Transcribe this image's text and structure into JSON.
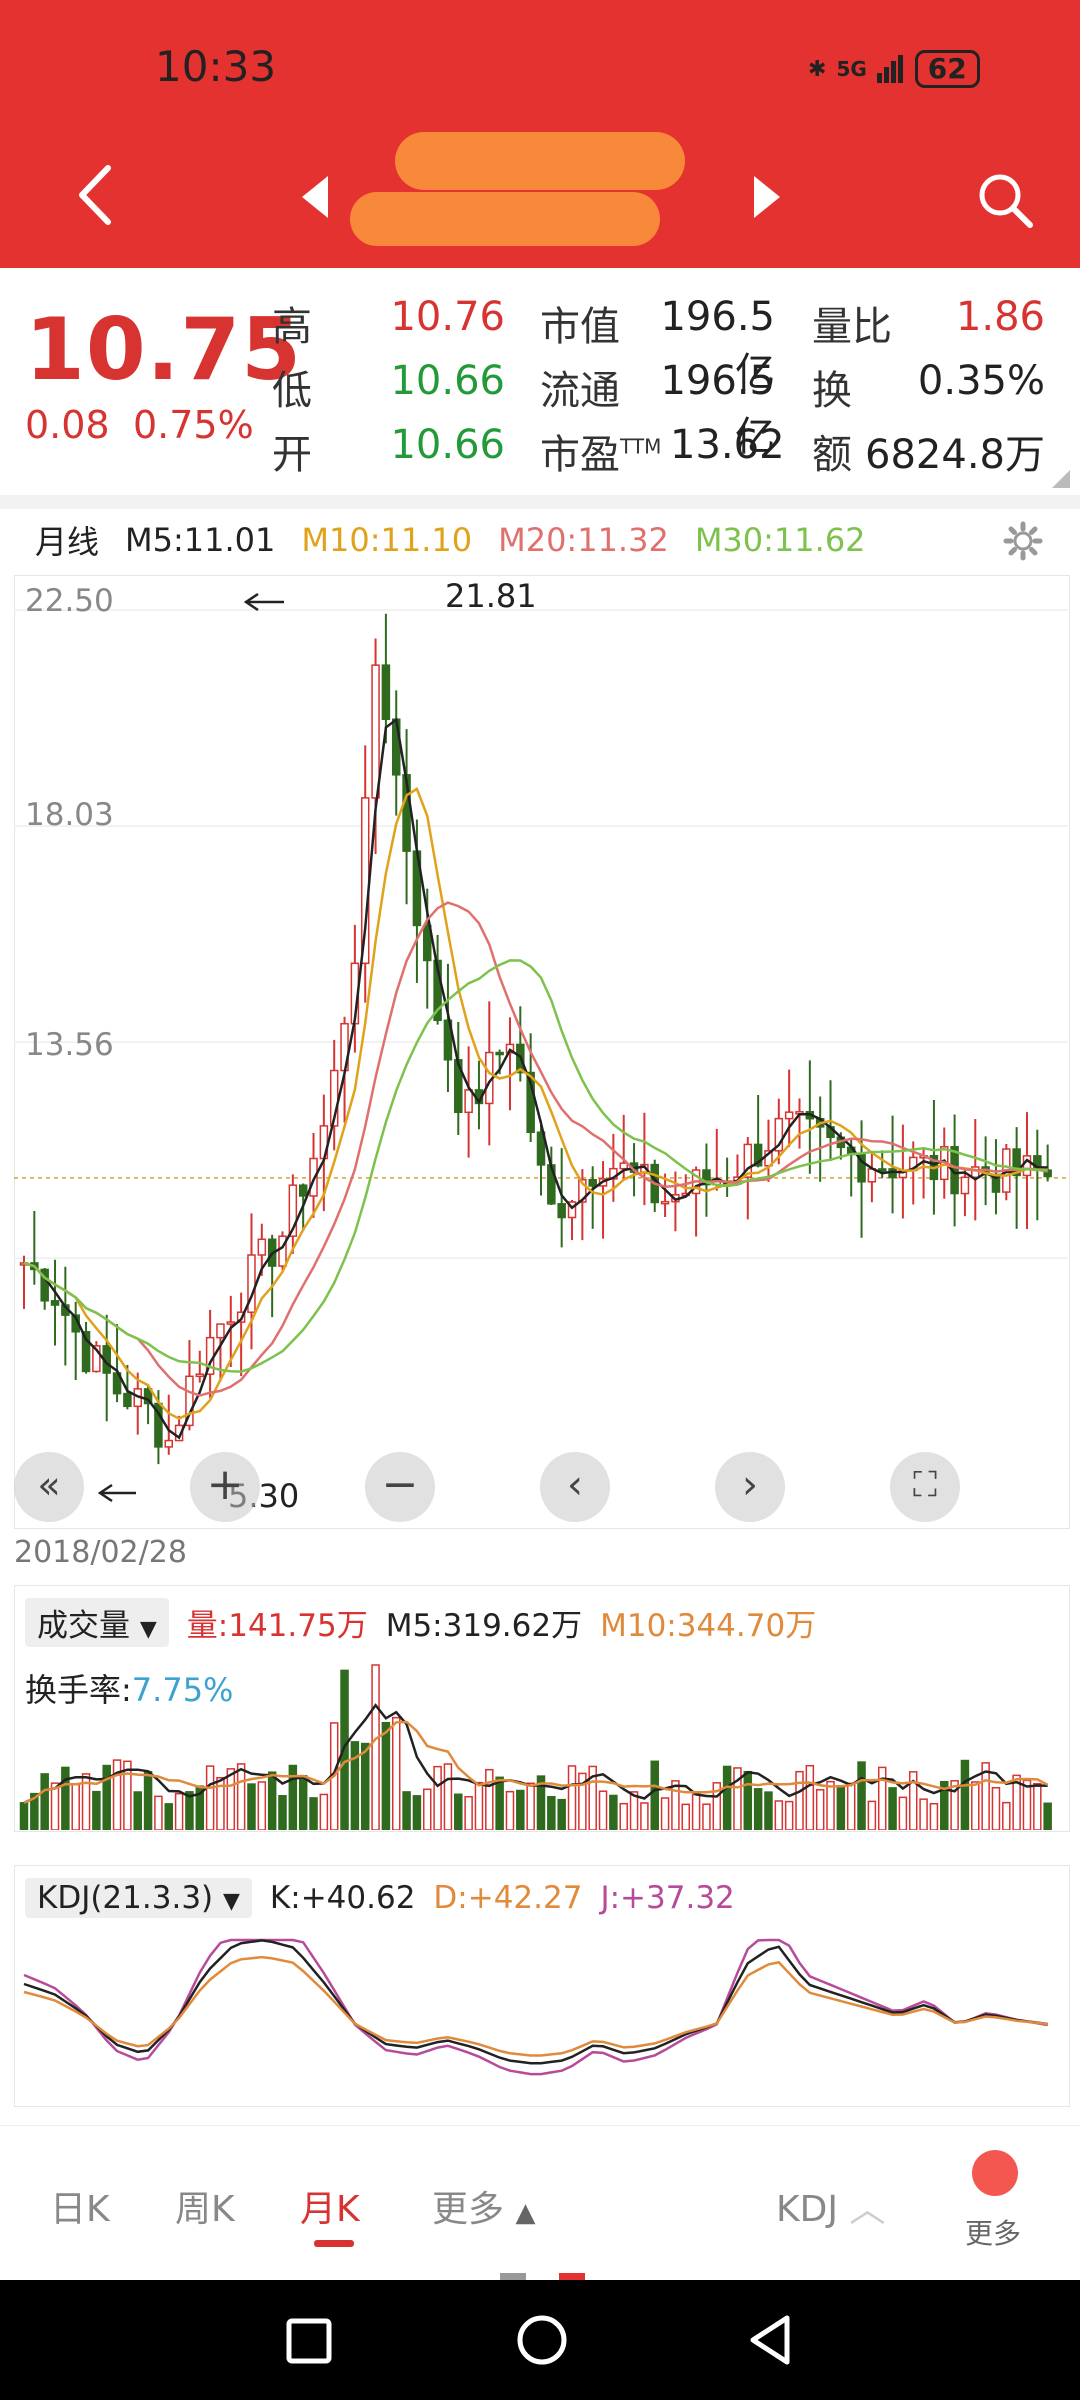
{
  "status_bar": {
    "time": "10:33",
    "network": "5G",
    "battery": "62"
  },
  "header": {
    "stock_name": ""
  },
  "quote": {
    "price": "10.75",
    "change": "0.08",
    "change_pct": "0.75%",
    "fields": [
      {
        "label": "高",
        "value": "10.76",
        "color": "#d63331"
      },
      {
        "label": "低",
        "value": "10.66",
        "color": "#229a3a"
      },
      {
        "label": "开",
        "value": "10.66",
        "color": "#229a3a"
      }
    ],
    "fields2": [
      {
        "label": "市值",
        "value": "196.5亿"
      },
      {
        "label": "流通",
        "value": "196.5亿"
      },
      {
        "label": "市盈TTM",
        "value": "13.62"
      }
    ],
    "fields3": [
      {
        "label": "量比",
        "value": "1.86",
        "color": "#d63331"
      },
      {
        "label": "换",
        "value": "0.35%",
        "color": "#222222"
      },
      {
        "label": "额",
        "value": "6824.8万",
        "color": "#222222"
      }
    ]
  },
  "ma_legend": {
    "period": "月线",
    "m5": "M5:11.01",
    "m10": "M10:11.10",
    "m20": "M20:11.32",
    "m30": "M30:11.62",
    "colors": {
      "m5": "#222222",
      "m10": "#e0a21b",
      "m20": "#e0706e",
      "m30": "#7cc24d"
    }
  },
  "chart_data": {
    "type": "candlestick",
    "y_ticks": [
      "22.50",
      "18.03",
      "13.56"
    ],
    "ylim": [
      4.5,
      22.5
    ],
    "annotations": {
      "high": "21.81",
      "low": "5.30",
      "current_line": 10.75
    },
    "date_label": "2018/02/28",
    "up_color": "#d63331",
    "down_color": "#2f6a1f"
  },
  "volume_panel": {
    "dropdown": "成交量",
    "vol": "量:141.75万",
    "m5": "M5:319.62万",
    "m10": "M10:344.70万",
    "turnover_label": "换手率:",
    "turnover_value": "7.75%"
  },
  "kdj_panel": {
    "dropdown": "KDJ(21.3.3)",
    "k": "K:+40.62",
    "d": "D:+42.27",
    "j": "J:+37.32"
  },
  "tabs": {
    "day": "日K",
    "week": "周K",
    "month": "月K",
    "more": "更多",
    "indicator": "KDJ",
    "more_right": "更多"
  }
}
